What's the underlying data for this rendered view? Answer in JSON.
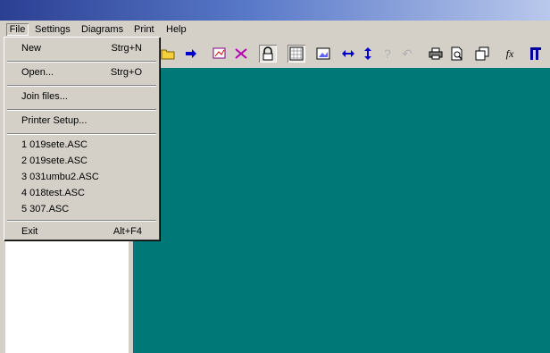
{
  "menubar": {
    "items": [
      {
        "label": "File"
      },
      {
        "label": "Settings"
      },
      {
        "label": "Diagrams"
      },
      {
        "label": "Print"
      },
      {
        "label": "Help"
      }
    ]
  },
  "file_menu": {
    "new": {
      "label": "New",
      "shortcut": "Strg+N"
    },
    "open": {
      "label": "Open...",
      "shortcut": "Strg+O"
    },
    "join": {
      "label": "Join files..."
    },
    "printer_setup": {
      "label": "Printer Setup..."
    },
    "recent": [
      {
        "label": "1 019sete.ASC"
      },
      {
        "label": "2 019sete.ASC"
      },
      {
        "label": "3 031umbu2.ASC"
      },
      {
        "label": "4 018test.ASC"
      },
      {
        "label": "5 307.ASC"
      }
    ],
    "exit": {
      "label": "Exit",
      "shortcut": "Alt+F4"
    }
  },
  "toolbar": {
    "icons": [
      "folder-icon",
      "arrow-right-icon",
      "select-diagram-icon",
      "cross-diagram-icon",
      "lock-icon",
      "grid-icon",
      "image-icon",
      "horizontal-arrows-icon",
      "vertical-arrows-icon",
      "help-cursor-icon",
      "undo-icon",
      "printer-icon",
      "print-preview-icon",
      "copy-windows-icon",
      "function-icon",
      "bracket-icon"
    ],
    "function_label": "fx"
  },
  "colors": {
    "main_area": "#007878",
    "chrome": "#d4d0c8",
    "title_start": "#2b3f93"
  }
}
